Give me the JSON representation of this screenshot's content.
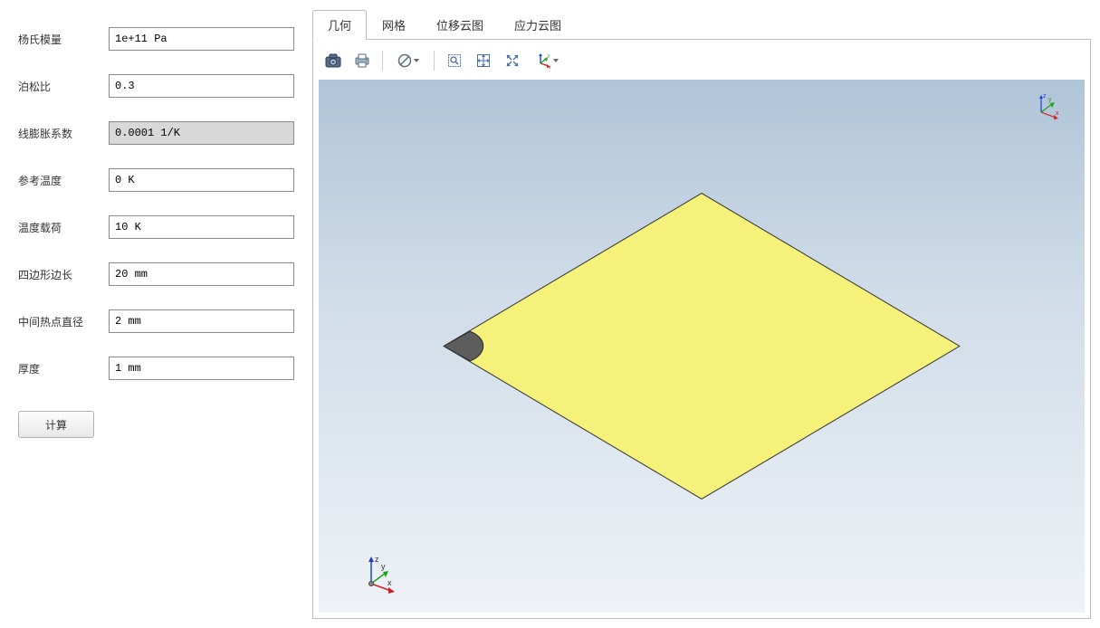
{
  "form": {
    "fields": [
      {
        "label": "杨氏模量",
        "value": "1e+11 Pa",
        "highlighted": false
      },
      {
        "label": "泊松比",
        "value": "0.3",
        "highlighted": false
      },
      {
        "label": "线膨胀系数",
        "value": "0.0001 1/K",
        "highlighted": true
      },
      {
        "label": "参考温度",
        "value": "0 K",
        "highlighted": false
      },
      {
        "label": "温度载荷",
        "value": "10 K",
        "highlighted": false
      },
      {
        "label": "四边形边长",
        "value": "20 mm",
        "highlighted": false
      },
      {
        "label": "中间热点直径",
        "value": "2 mm",
        "highlighted": false
      },
      {
        "label": "厚度",
        "value": "1 mm",
        "highlighted": false
      }
    ],
    "calc_button": "计算"
  },
  "tabs": [
    {
      "label": "几何",
      "active": true
    },
    {
      "label": "网格",
      "active": false
    },
    {
      "label": "位移云图",
      "active": false
    },
    {
      "label": "应力云图",
      "active": false
    }
  ],
  "toolbar_icons": {
    "screenshot": "camera-icon",
    "print": "print-icon",
    "transparency": "circle-slash-icon",
    "zoom_box": "zoom-box-icon",
    "zoom_extents": "zoom-extents-icon",
    "zoom_selection": "zoom-selection-icon",
    "orient": "axis-orient-icon"
  },
  "axis_labels": {
    "x": "x",
    "y": "y",
    "z": "z"
  },
  "colors": {
    "plate_fill": "#f5f17a",
    "plate_stroke": "#2a2a2a",
    "spot_fill": "#5d5d5d",
    "axis_x_color": "#d02020",
    "axis_y_color": "#20a020",
    "axis_z_color": "#2040d0"
  }
}
